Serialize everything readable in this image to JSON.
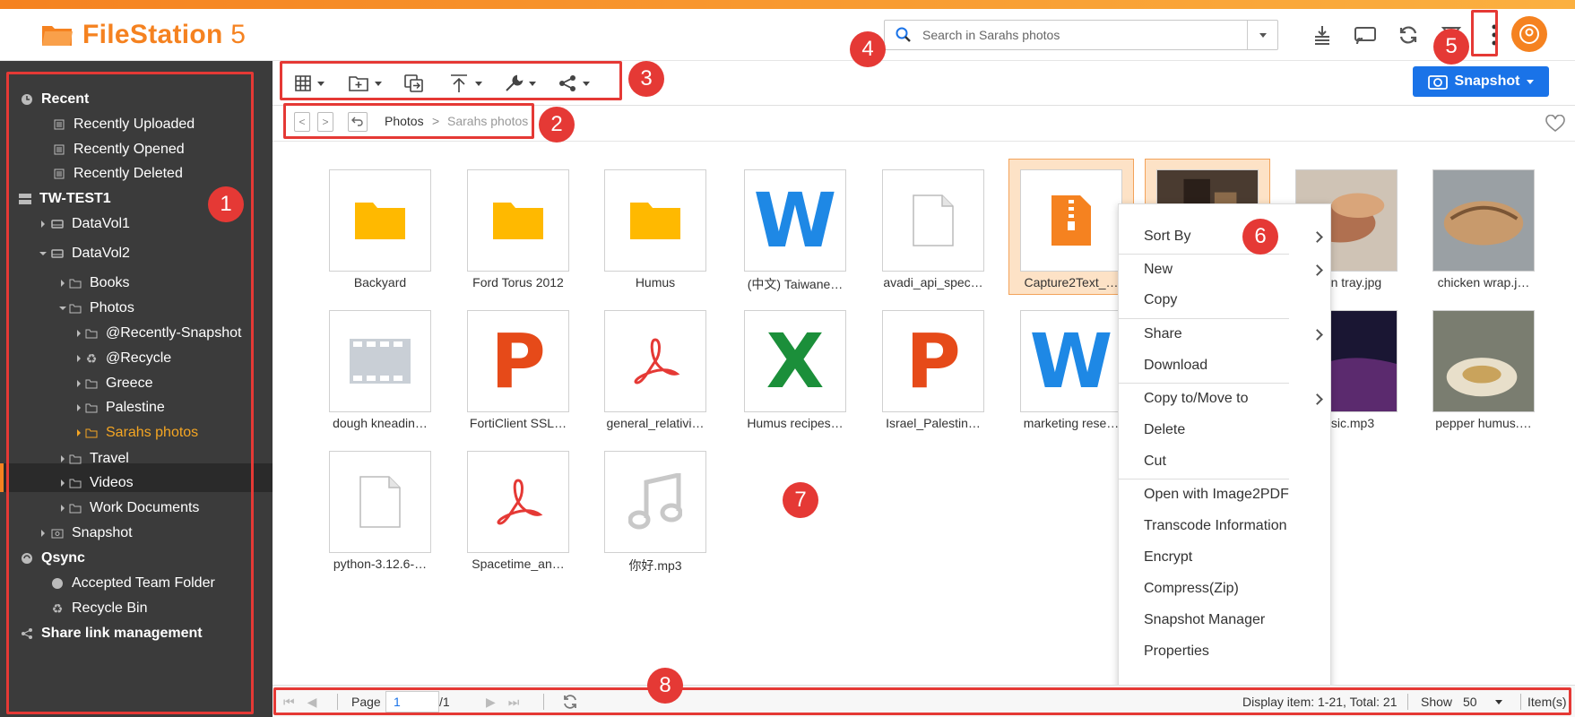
{
  "app": {
    "name": "FileStation",
    "version": "5"
  },
  "search": {
    "placeholder": "Search in Sarahs photos"
  },
  "header_icons": [
    "upload-queue-icon",
    "cast-icon",
    "refresh-icon",
    "filter-icon",
    "more-vertical-icon"
  ],
  "toolbar": {
    "snapshot_label": "Snapshot"
  },
  "breadcrumb": {
    "items": [
      "Photos",
      "Sarahs photos"
    ]
  },
  "sidebar": {
    "items": [
      {
        "label": "Recent"
      },
      {
        "label": "Recently Uploaded"
      },
      {
        "label": "Recently Opened"
      },
      {
        "label": "Recently Deleted"
      },
      {
        "label": "TW-TEST1"
      },
      {
        "label": "DataVol1"
      },
      {
        "label": "DataVol2"
      },
      {
        "label": "Books"
      },
      {
        "label": "Photos"
      },
      {
        "label": "@Recently-Snapshot"
      },
      {
        "label": "@Recycle"
      },
      {
        "label": "Greece"
      },
      {
        "label": "Palestine"
      },
      {
        "label": "Sarahs photos"
      },
      {
        "label": "Travel"
      },
      {
        "label": "Videos"
      },
      {
        "label": "Work Documents"
      },
      {
        "label": "Snapshot"
      },
      {
        "label": "Qsync"
      },
      {
        "label": "Accepted Team Folder"
      },
      {
        "label": "Recycle Bin"
      },
      {
        "label": "Share link management"
      }
    ]
  },
  "files": [
    {
      "name": "Backyard",
      "type": "folder"
    },
    {
      "name": "Ford Torus 2012",
      "type": "folder"
    },
    {
      "name": "Humus",
      "type": "folder"
    },
    {
      "name": "(中文) Taiwane…",
      "type": "word"
    },
    {
      "name": "avadi_api_spec…",
      "type": "generic"
    },
    {
      "name": "Capture2Text_…",
      "type": "zip"
    },
    {
      "name": "",
      "type": "photo"
    },
    {
      "name": "…en tray.jpg",
      "type": "photo"
    },
    {
      "name": "chicken wrap.j…",
      "type": "photo"
    },
    {
      "name": "dough kneadin…",
      "type": "video"
    },
    {
      "name": "FortiClient SSL…",
      "type": "ppt"
    },
    {
      "name": "general_relativi…",
      "type": "pdf"
    },
    {
      "name": "Humus recipes…",
      "type": "excel"
    },
    {
      "name": "Israel_Palestin…",
      "type": "ppt"
    },
    {
      "name": "marketing rese…",
      "type": "word"
    },
    {
      "name": "…sic.mp3",
      "type": "photo"
    },
    {
      "name": "pepper humus.…",
      "type": "photo"
    },
    {
      "name": "python-3.12.6-…",
      "type": "generic"
    },
    {
      "name": "Spacetime_an…",
      "type": "pdf"
    },
    {
      "name": "你好.mp3",
      "type": "music"
    }
  ],
  "context_menu": {
    "items": [
      {
        "label": "Sort By",
        "submenu": true
      },
      {
        "label": "New",
        "submenu": true
      },
      {
        "label": "Copy",
        "submenu": false
      },
      {
        "label": "Share",
        "submenu": true
      },
      {
        "label": "Download",
        "submenu": false
      },
      {
        "label": "Copy to/Move to",
        "submenu": true
      },
      {
        "label": "Delete",
        "submenu": false
      },
      {
        "label": "Cut",
        "submenu": false
      },
      {
        "label": "Open with Image2PDF",
        "submenu": false
      },
      {
        "label": "Transcode Information",
        "submenu": false
      },
      {
        "label": "Encrypt",
        "submenu": false
      },
      {
        "label": "Compress(Zip)",
        "submenu": false
      },
      {
        "label": "Snapshot Manager",
        "submenu": false
      },
      {
        "label": "Properties",
        "submenu": false
      }
    ]
  },
  "statusbar": {
    "page_label": "Page",
    "page_value": "1",
    "page_total": "/1",
    "display_info": "Display item: 1-21, Total: 21",
    "show_label": "Show",
    "show_value": "50",
    "items_label": "Item(s)"
  },
  "callouts": [
    "1",
    "2",
    "3",
    "4",
    "5",
    "6",
    "7",
    "8"
  ],
  "colors": {
    "accent": "#f58220",
    "primary": "#1a73e8",
    "callout": "#e53935",
    "sidebar": "#3b3b3b",
    "folder": "#ffb900",
    "word": "#1e88e5",
    "ppt": "#e64a19",
    "excel": "#1b8f3a",
    "pdf": "#e53935"
  }
}
